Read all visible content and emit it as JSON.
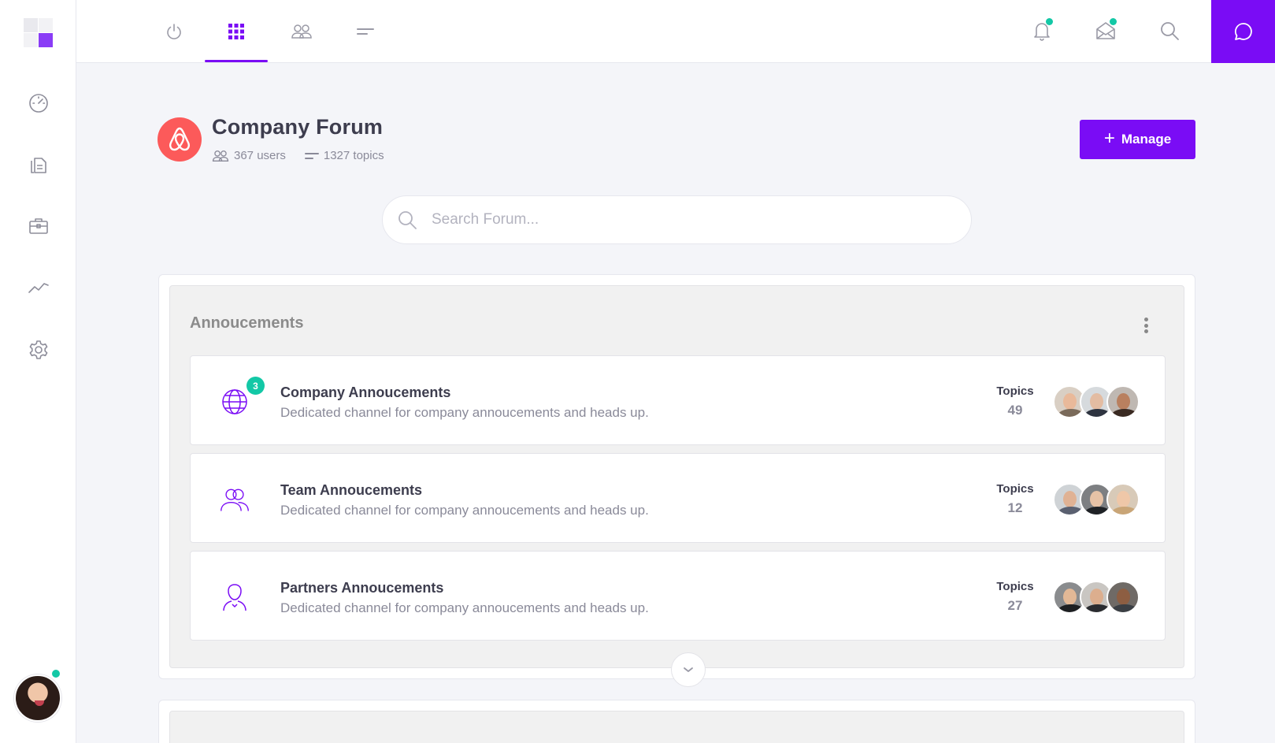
{
  "nav": {
    "top_tabs": [
      {
        "icon": "power-icon"
      },
      {
        "icon": "grid-icon",
        "active": true
      },
      {
        "icon": "users-icon"
      },
      {
        "icon": "menu-lines-icon"
      }
    ],
    "sidebar_items": [
      {
        "icon": "dashboard-gauge-icon"
      },
      {
        "icon": "documents-icon"
      },
      {
        "icon": "briefcase-icon"
      },
      {
        "icon": "trend-chart-icon"
      },
      {
        "icon": "settings-gear-icon"
      }
    ],
    "top_right": [
      "bell-icon",
      "mail-icon",
      "search-icon",
      "chat-bubble-icon"
    ]
  },
  "header": {
    "title": "Company Forum",
    "users": "367 users",
    "topics": "1327 topics",
    "manage_label": "Manage"
  },
  "search": {
    "placeholder": "Search Forum..."
  },
  "group": {
    "title": "Annoucements",
    "channels": [
      {
        "name": "Company Annoucements",
        "description": "Dedicated channel for company annoucements and heads up.",
        "topics_label": "Topics",
        "topics_count": "49",
        "icon": "globe-icon",
        "new_count": "3"
      },
      {
        "name": "Team Annoucements",
        "description": "Dedicated channel for company annoucements and heads up.",
        "topics_label": "Topics",
        "topics_count": "12",
        "icon": "team-users-icon"
      },
      {
        "name": "Partners Annoucements",
        "description": "Dedicated channel for company annoucements and heads up.",
        "topics_label": "Topics",
        "topics_count": "27",
        "icon": "partner-user-icon"
      }
    ]
  },
  "colors": {
    "accent": "#7a0cf5",
    "online": "#13c8a6",
    "brand_logo": "#fc5a5a"
  }
}
